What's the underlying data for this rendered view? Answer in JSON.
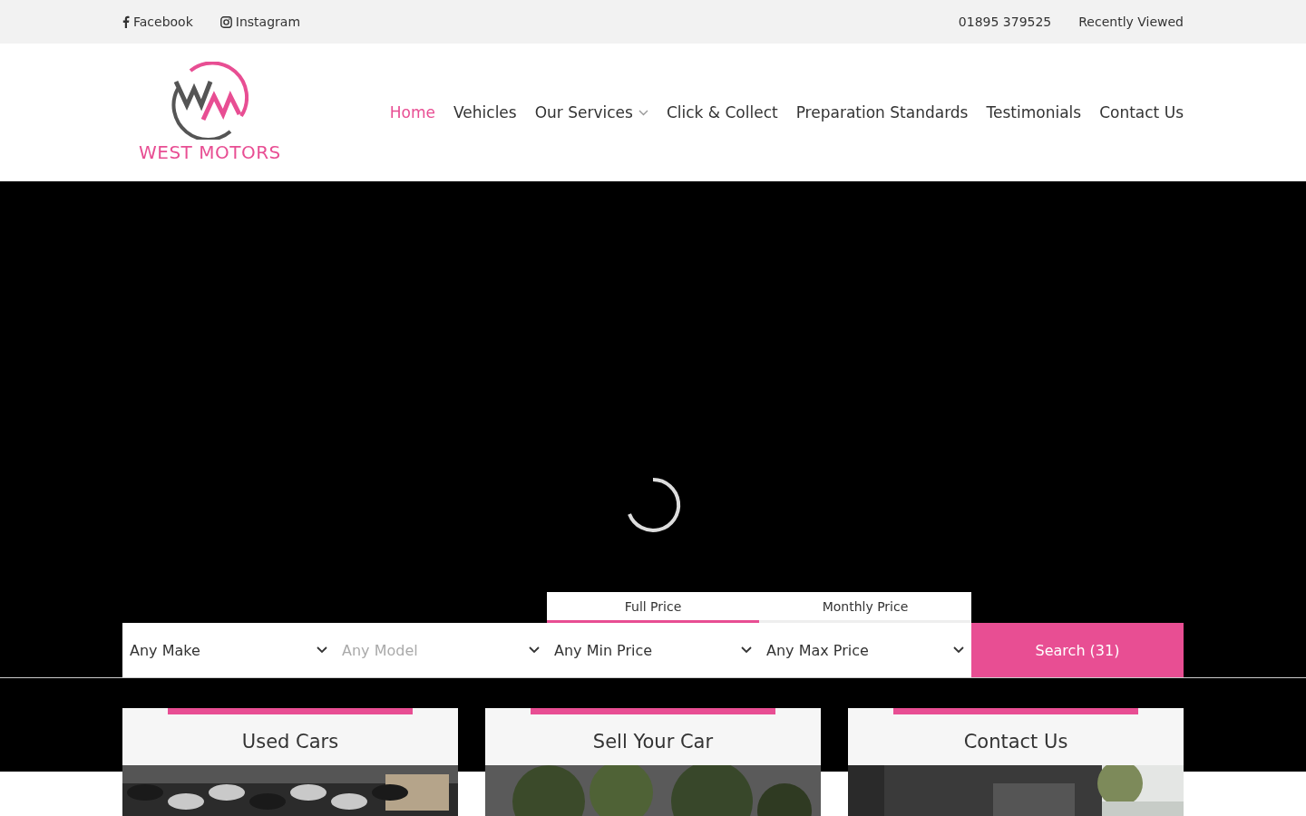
{
  "top_bar": {
    "social_links": [
      {
        "kind": "facebook",
        "label": "Facebook"
      },
      {
        "kind": "instagram",
        "label": "Instagram"
      }
    ],
    "phone": "01895 379525",
    "recently_viewed": "Recently Viewed"
  },
  "header": {
    "logo_text": "WEST MOTORS",
    "nav": [
      {
        "label": "Home",
        "selected": true,
        "dropdown": false
      },
      {
        "label": "Vehicles",
        "selected": false,
        "dropdown": false
      },
      {
        "label": "Our Services",
        "selected": false,
        "dropdown": true
      },
      {
        "label": "Click & Collect",
        "selected": false,
        "dropdown": false
      },
      {
        "label": "Preparation Standards",
        "selected": false,
        "dropdown": false
      },
      {
        "label": "Testimonials",
        "selected": false,
        "dropdown": false
      },
      {
        "label": "Contact Us",
        "selected": false,
        "dropdown": false
      }
    ]
  },
  "search": {
    "price_tabs": [
      {
        "label": "Full Price",
        "selected": true
      },
      {
        "label": "Monthly Price",
        "selected": false
      }
    ],
    "filters": [
      {
        "value": "Any Make",
        "disabled": false
      },
      {
        "value": "Any Model",
        "disabled": true
      },
      {
        "value": "Any Min Price",
        "disabled": false
      },
      {
        "value": "Any Max Price",
        "disabled": false
      }
    ],
    "button": "Search (31)"
  },
  "cards": [
    {
      "title": "Used Cars",
      "kind": "picture"
    },
    {
      "title": "Sell Your Car",
      "kind": "picture"
    },
    {
      "title": "Contact Us",
      "kind": "picture"
    }
  ]
}
